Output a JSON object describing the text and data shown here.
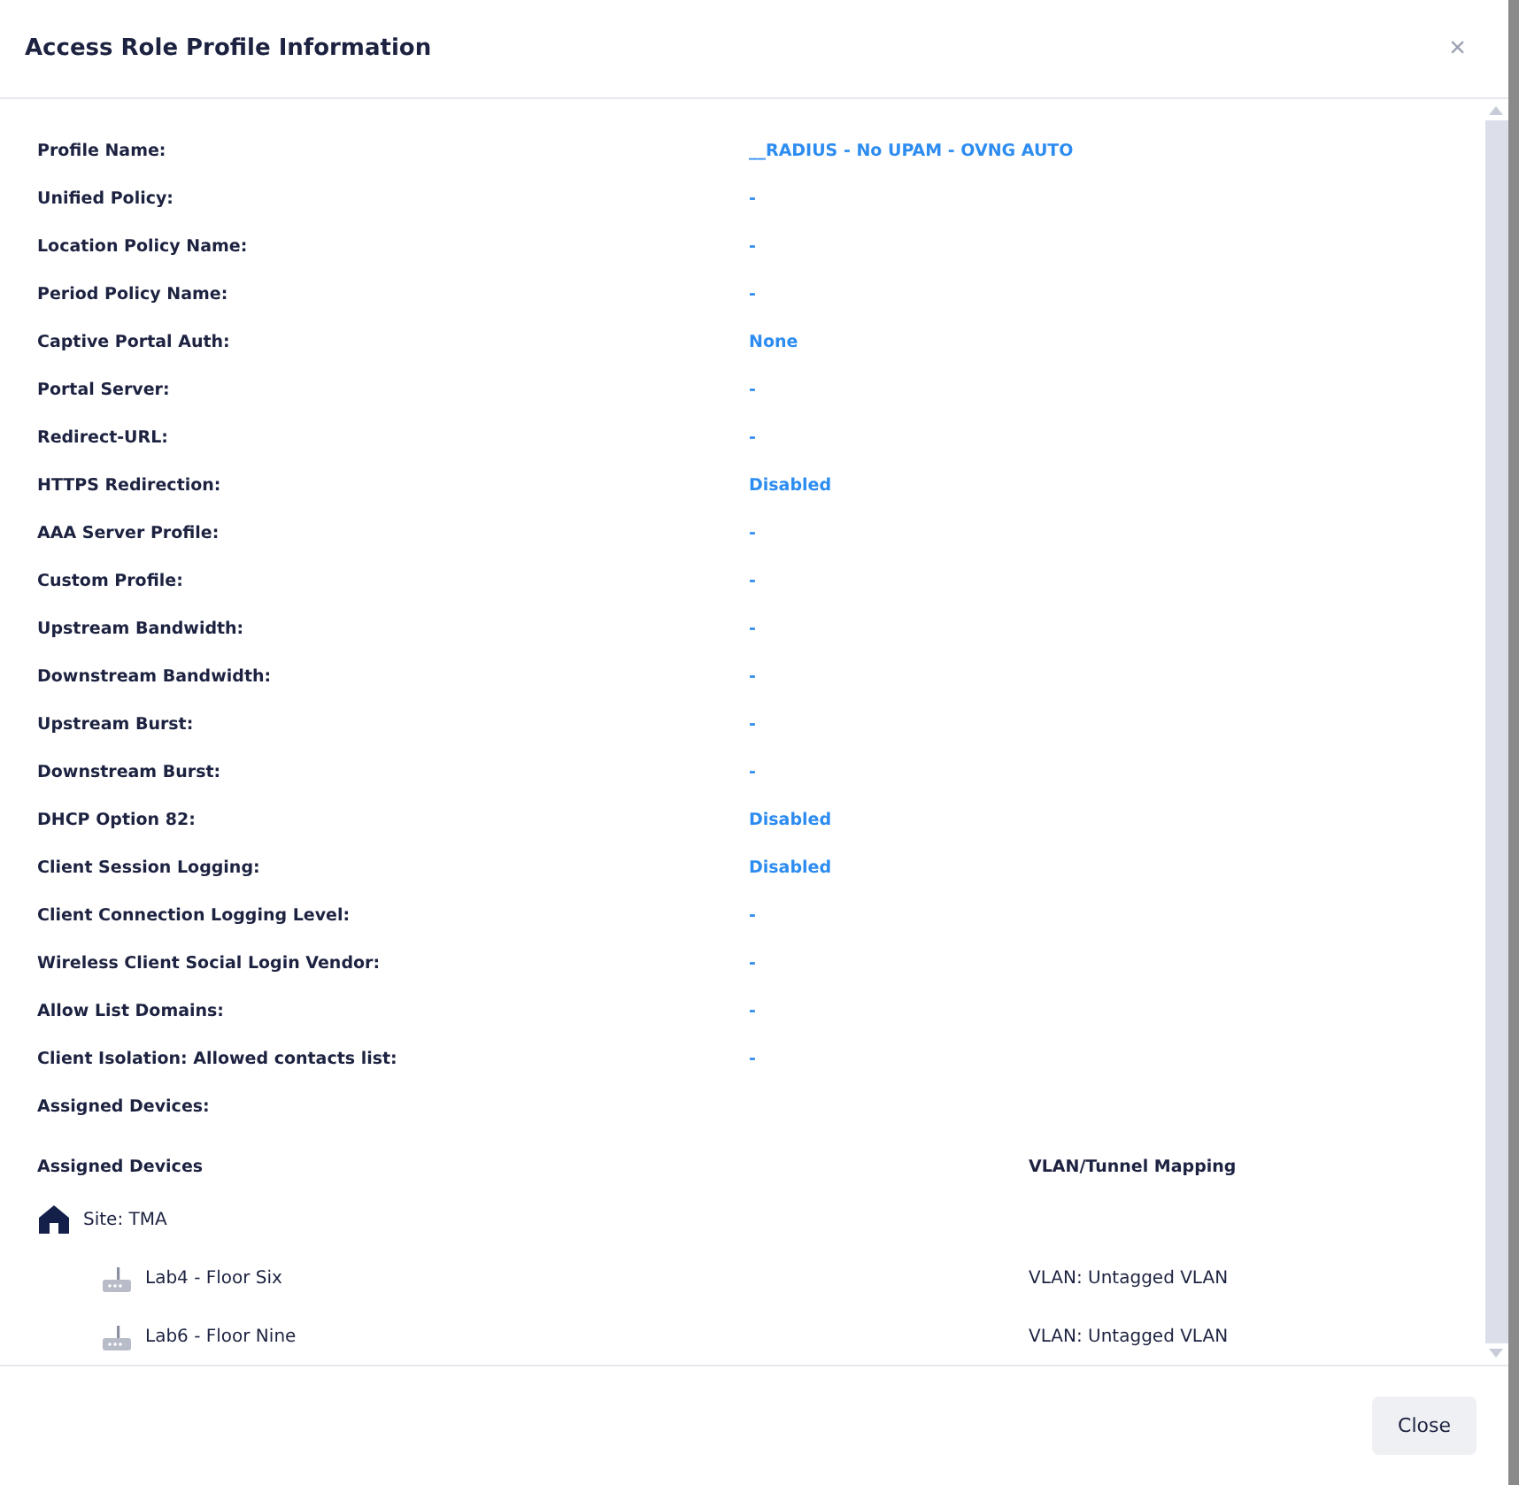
{
  "dialog": {
    "title": "Access Role Profile Information",
    "close_icon": "×"
  },
  "fields": [
    {
      "label": "Profile Name:",
      "value": "__RADIUS - No UPAM - OVNG AUTO"
    },
    {
      "label": "Unified Policy:",
      "value": "-"
    },
    {
      "label": "Location Policy Name:",
      "value": "-"
    },
    {
      "label": "Period Policy Name:",
      "value": "-"
    },
    {
      "label": "Captive Portal Auth:",
      "value": "None"
    },
    {
      "label": "Portal Server:",
      "value": "-"
    },
    {
      "label": "Redirect-URL:",
      "value": "-"
    },
    {
      "label": "HTTPS Redirection:",
      "value": "Disabled"
    },
    {
      "label": "AAA Server Profile:",
      "value": "-"
    },
    {
      "label": "Custom Profile:",
      "value": "-"
    },
    {
      "label": "Upstream Bandwidth:",
      "value": "-"
    },
    {
      "label": "Downstream Bandwidth:",
      "value": "-"
    },
    {
      "label": "Upstream Burst:",
      "value": "-"
    },
    {
      "label": "Downstream Burst:",
      "value": "-"
    },
    {
      "label": "DHCP Option 82:",
      "value": "Disabled"
    },
    {
      "label": "Client Session Logging:",
      "value": "Disabled"
    },
    {
      "label": "Client Connection Logging Level:",
      "value": "-"
    },
    {
      "label": "Wireless Client Social Login Vendor:",
      "value": "-"
    },
    {
      "label": "Allow List Domains:",
      "value": "-"
    },
    {
      "label": "Client Isolation: Allowed contacts list:",
      "value": "-"
    },
    {
      "label": "Assigned Devices:"
    }
  ],
  "devices_table": {
    "columns": [
      "Assigned Devices",
      "VLAN/Tunnel Mapping"
    ],
    "site": {
      "name": "Site: TMA",
      "children": [
        {
          "name": "Lab4 - Floor Six",
          "mapping": "VLAN: Untagged VLAN"
        },
        {
          "name": "Lab6 - Floor Nine",
          "mapping": "VLAN: Untagged VLAN"
        }
      ]
    }
  },
  "buttons": [
    "Close"
  ]
}
